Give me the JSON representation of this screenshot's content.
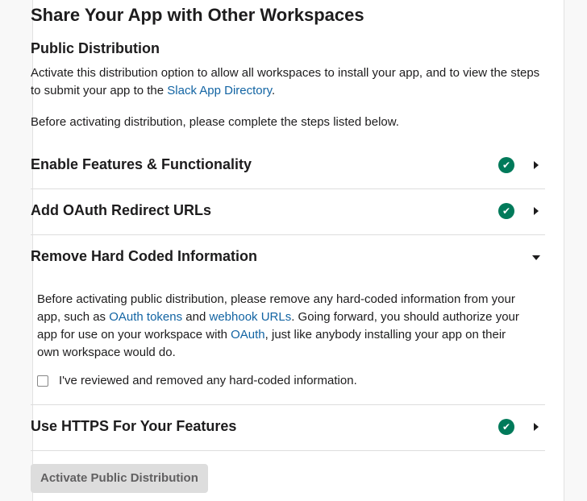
{
  "page": {
    "title": "Share Your App with Other Workspaces",
    "subtitle": "Public Distribution",
    "intro_text_before": "Activate this distribution option to allow all workspaces to install your app, and to view the steps to submit your app to the ",
    "intro_link": "Slack App Directory",
    "intro_text_after": ".",
    "steps_note": "Before activating distribution, please complete the steps listed below."
  },
  "sections": [
    {
      "title": "Enable Features & Functionality",
      "complete": true,
      "expanded": false
    },
    {
      "title": "Add OAuth Redirect URLs",
      "complete": true,
      "expanded": false
    },
    {
      "title": "Remove Hard Coded Information",
      "complete": false,
      "expanded": true
    },
    {
      "title": "Use HTTPS For Your Features",
      "complete": true,
      "expanded": false
    }
  ],
  "hardcoded": {
    "text1": "Before activating public distribution, please remove any hard-coded information from your app, such as ",
    "link1": "OAuth tokens",
    "text2": " and ",
    "link2": "webhook URLs",
    "text3": ". Going forward, you should authorize your app for use on your workspace with ",
    "link3": "OAuth",
    "text4": ", just like anybody installing your app on their own workspace would do.",
    "checkbox_label": "I've reviewed and removed any hard-coded information.",
    "checkbox_checked": false
  },
  "icons": {
    "check": "✔"
  },
  "activate_button": "Activate Public Distribution",
  "colors": {
    "success": "#007a5a",
    "link": "#1264a3"
  }
}
